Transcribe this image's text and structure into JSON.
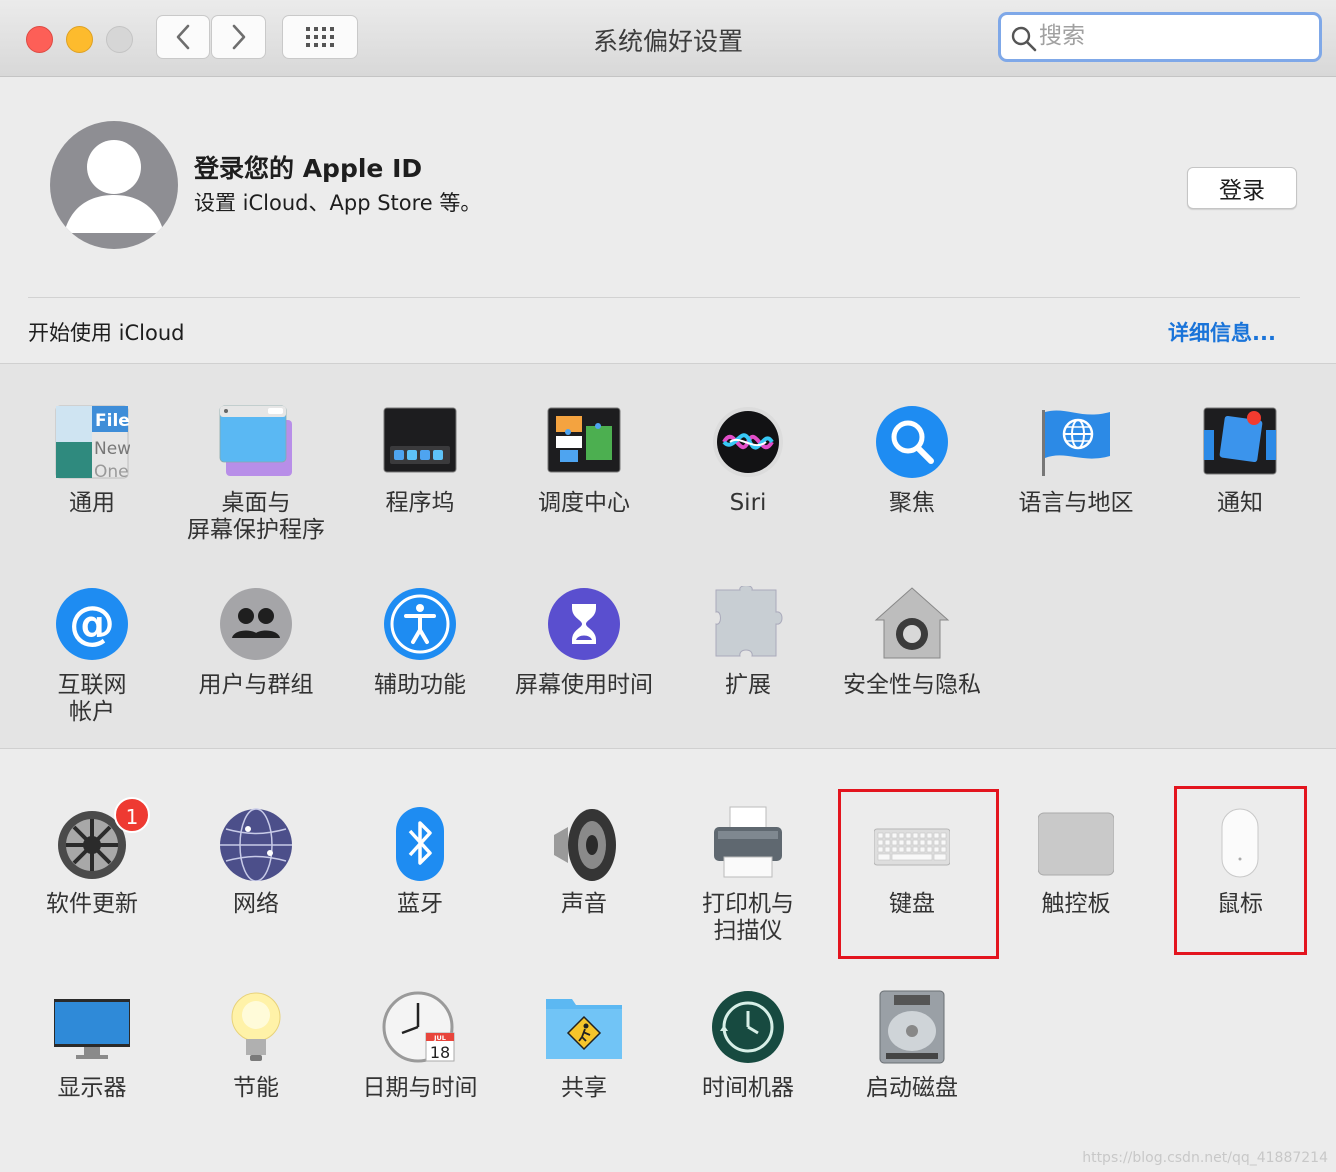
{
  "window": {
    "title": "系统偏好设置"
  },
  "search": {
    "placeholder": "搜索"
  },
  "account": {
    "title": "登录您的 Apple ID",
    "subtitle": "设置 iCloud、App Store 等。",
    "login_label": "登录"
  },
  "icloud": {
    "text": "开始使用 iCloud",
    "details_label": "详细信息..."
  },
  "row1": [
    {
      "label": "通用",
      "icon": "general-icon"
    },
    {
      "label": "桌面与\n屏幕保护程序",
      "icon": "desktop-screensaver-icon"
    },
    {
      "label": "程序坞",
      "icon": "dock-icon"
    },
    {
      "label": "调度中心",
      "icon": "mission-control-icon"
    },
    {
      "label": "Siri",
      "icon": "siri-icon"
    },
    {
      "label": "聚焦",
      "icon": "spotlight-icon"
    },
    {
      "label": "语言与地区",
      "icon": "language-region-icon"
    },
    {
      "label": "通知",
      "icon": "notifications-icon"
    }
  ],
  "row2": [
    {
      "label": "互联网\n帐户",
      "icon": "internet-accounts-icon"
    },
    {
      "label": "用户与群组",
      "icon": "users-groups-icon"
    },
    {
      "label": "辅助功能",
      "icon": "accessibility-icon"
    },
    {
      "label": "屏幕使用时间",
      "icon": "screen-time-icon"
    },
    {
      "label": "扩展",
      "icon": "extensions-icon"
    },
    {
      "label": "安全性与隐私",
      "icon": "security-privacy-icon"
    }
  ],
  "row3": [
    {
      "label": "软件更新",
      "icon": "software-update-icon",
      "badge": "1"
    },
    {
      "label": "网络",
      "icon": "network-icon"
    },
    {
      "label": "蓝牙",
      "icon": "bluetooth-icon"
    },
    {
      "label": "声音",
      "icon": "sound-icon"
    },
    {
      "label": "打印机与\n扫描仪",
      "icon": "printers-scanners-icon"
    },
    {
      "label": "键盘",
      "icon": "keyboard-icon"
    },
    {
      "label": "触控板",
      "icon": "trackpad-icon"
    },
    {
      "label": "鼠标",
      "icon": "mouse-icon"
    }
  ],
  "row4": [
    {
      "label": "显示器",
      "icon": "displays-icon"
    },
    {
      "label": "节能",
      "icon": "energy-saver-icon"
    },
    {
      "label": "日期与时间",
      "icon": "date-time-icon",
      "calendar_month": "JUL",
      "calendar_day": "18"
    },
    {
      "label": "共享",
      "icon": "sharing-icon"
    },
    {
      "label": "时间机器",
      "icon": "time-machine-icon"
    },
    {
      "label": "启动磁盘",
      "icon": "startup-disk-icon"
    }
  ],
  "general_icon_text": [
    "File",
    "New",
    "One"
  ],
  "colors": {
    "highlight": "#e3141e",
    "link": "#1a74d9",
    "badge": "#ee3a32"
  },
  "watermark": "https://blog.csdn.net/qq_41887214"
}
